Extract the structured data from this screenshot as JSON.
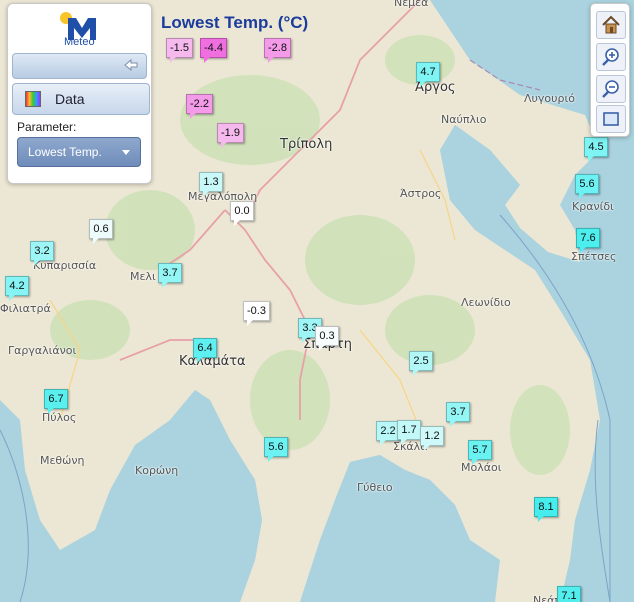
{
  "app": {
    "logo_text": "Meteo",
    "title": "Lowest Temp. (°C)"
  },
  "panel": {
    "data_button_label": "Data",
    "parameter_label": "Parameter:",
    "parameter_value": "Lowest Temp."
  },
  "toolbar": {
    "icons": [
      "home-icon",
      "zoom-in-icon",
      "zoom-out-icon",
      "full-extent-icon"
    ]
  },
  "map": {
    "places": [
      {
        "name": "Νεμέα",
        "cls": ""
      },
      {
        "name": "Άργος",
        "cls": "city"
      },
      {
        "name": "Λυγουριό",
        "cls": ""
      },
      {
        "name": "Ναύπλιο",
        "cls": ""
      },
      {
        "name": "Τρίπολη",
        "cls": "city"
      },
      {
        "name": "Άστρος",
        "cls": ""
      },
      {
        "name": "Κρανίδι",
        "cls": ""
      },
      {
        "name": "Σπέτσες",
        "cls": ""
      },
      {
        "name": "Μεγαλόπολη",
        "cls": ""
      },
      {
        "name": "Κυπαρισσία",
        "cls": ""
      },
      {
        "name": "Μελι",
        "cls": ""
      },
      {
        "name": "Φιλιατρά",
        "cls": ""
      },
      {
        "name": "Γαργαλιάνοι",
        "cls": ""
      },
      {
        "name": "Λεωνίδιο",
        "cls": ""
      },
      {
        "name": "Σπάρτη",
        "cls": "city"
      },
      {
        "name": "Καλαμάτα",
        "cls": "city"
      },
      {
        "name": "Πύλος",
        "cls": ""
      },
      {
        "name": "Μεθώνη",
        "cls": ""
      },
      {
        "name": "Κορώνη",
        "cls": ""
      },
      {
        "name": "Σκάλα",
        "cls": ""
      },
      {
        "name": "Μολάοι",
        "cls": ""
      },
      {
        "name": "Γύθειο",
        "cls": ""
      },
      {
        "name": "Νεάπ",
        "cls": ""
      }
    ],
    "stations": [
      {
        "value": "-1.5",
        "color": "#f6b9ee"
      },
      {
        "value": "-4.4",
        "color": "#ef6fe0"
      },
      {
        "value": "-2.8",
        "color": "#f39be8"
      },
      {
        "value": "-2.2",
        "color": "#f39be8"
      },
      {
        "value": "-1.9",
        "color": "#f6b9ee"
      },
      {
        "value": "4.7",
        "color": "#7ef4f4"
      },
      {
        "value": "4.5",
        "color": "#7ef4f4"
      },
      {
        "value": "5.6",
        "color": "#6cf2f2"
      },
      {
        "value": "7.6",
        "color": "#4ceeee"
      },
      {
        "value": "1.3",
        "color": "#c9f8f8"
      },
      {
        "value": "0.0",
        "color": "#ffffff"
      },
      {
        "value": "0.6",
        "color": "#eefbfb"
      },
      {
        "value": "3.2",
        "color": "#9ef5f5"
      },
      {
        "value": "3.7",
        "color": "#94f5f5"
      },
      {
        "value": "4.2",
        "color": "#86f4f4"
      },
      {
        "value": "-0.3",
        "color": "#ffffff"
      },
      {
        "value": "3.3",
        "color": "#9ef5f5"
      },
      {
        "value": "0.3",
        "color": "#f7fcfc"
      },
      {
        "value": "6.4",
        "color": "#5ef0f0"
      },
      {
        "value": "2.5",
        "color": "#b2f7f7"
      },
      {
        "value": "6.7",
        "color": "#5aefef"
      },
      {
        "value": "2.2",
        "color": "#b8f7f7"
      },
      {
        "value": "1.7",
        "color": "#c3f8f8"
      },
      {
        "value": "1.2",
        "color": "#cff9f9"
      },
      {
        "value": "3.7",
        "color": "#94f5f5"
      },
      {
        "value": "5.6",
        "color": "#6cf2f2"
      },
      {
        "value": "5.7",
        "color": "#6af2f2"
      },
      {
        "value": "8.1",
        "color": "#46eded"
      },
      {
        "value": "7.1",
        "color": "#52eeee"
      }
    ]
  }
}
